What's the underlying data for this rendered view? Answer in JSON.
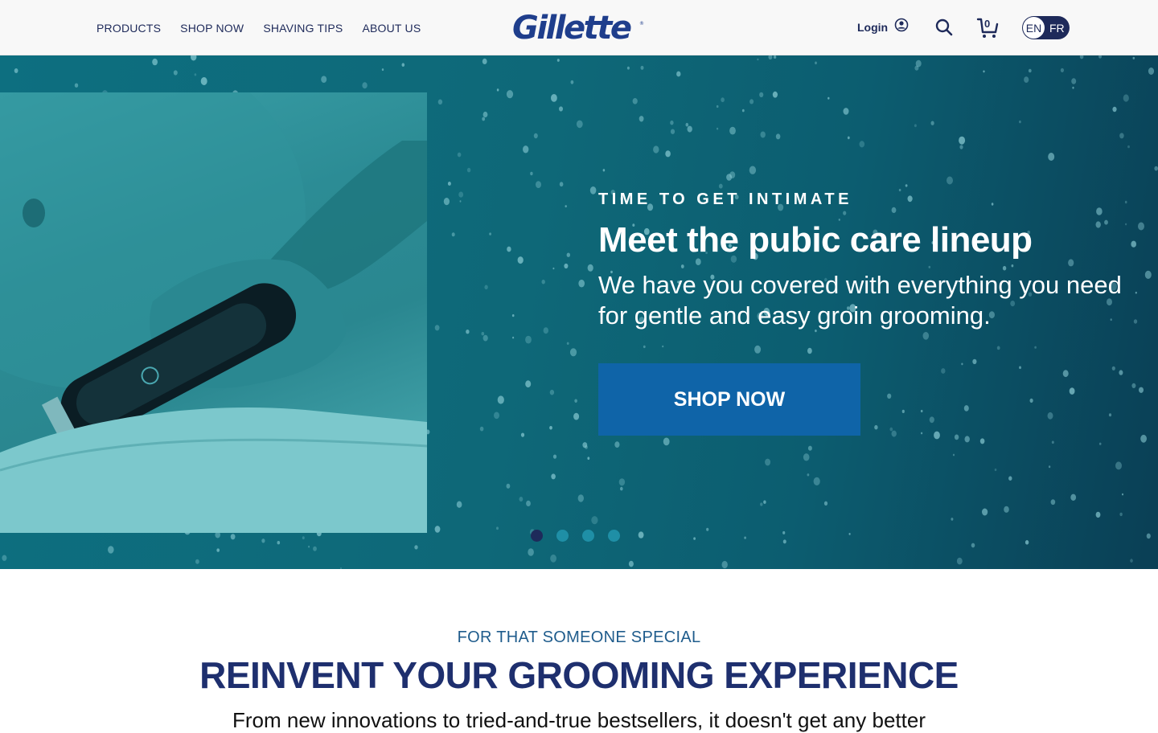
{
  "nav": {
    "items": [
      {
        "label": "PRODUCTS"
      },
      {
        "label": "SHOP NOW"
      },
      {
        "label": "SHAVING TIPS"
      },
      {
        "label": "ABOUT US"
      }
    ]
  },
  "brand": {
    "logo_text": "Gillette",
    "registered_mark": "®",
    "color": "#1f3e8c"
  },
  "header": {
    "login_label": "Login",
    "login_icon": "user-circle-icon",
    "search_icon": "search-icon",
    "cart_icon": "shopping-cart-icon",
    "cart_count": "0",
    "lang_en": "EN",
    "lang_fr": "FR",
    "active_lang": "EN"
  },
  "hero": {
    "eyebrow": "TIME TO GET INTIMATE",
    "headline": "Meet the pubic care lineup",
    "subhead": "We have you covered with everything you need for gentle and easy groin grooming.",
    "cta_label": "SHOP NOW",
    "cta_color": "#0f64a8",
    "background_color": "#0d6f80",
    "carousel_dots": 4,
    "carousel_active_index": 0
  },
  "intro": {
    "eyebrow": "FOR THAT SOMEONE SPECIAL",
    "title": "REINVENT YOUR GROOMING EXPERIENCE",
    "body": "From new innovations to tried-and-true bestsellers, it doesn't get any better"
  }
}
